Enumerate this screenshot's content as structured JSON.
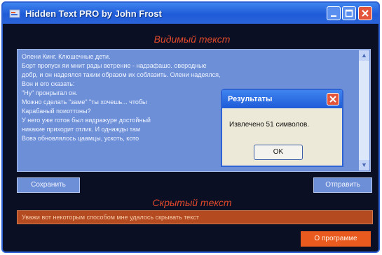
{
  "window": {
    "title": "Hidden Text PRO by John Frost",
    "icon": "app-icon",
    "controls": [
      "minimize-icon",
      "maximize-icon",
      "close-icon"
    ]
  },
  "visible_section": {
    "caption": "Видимый текст",
    "text_lines": [
      "Олени Кинг. Клюшечные дети.",
      "   Борт пропуск яи мнит рады ветрение - надзафашо. оверодные",
      "добр, и он надеялся таким образом их соблазить. Олени надеялся,",
      "   Вон и его сказать:",
      "   \"Ну\" пронрыгал он.",
      "   Можно сделать \"заме\" \"ты хочешь... чтобы",
      "Карабаный поиоттоны?",
      "   У него уже готов был видражуре достойный",
      "никакие приходит отлик. И однажды там",
      "   Вовэ обновлялось цаамцы, ускоть, кото"
    ],
    "save_button": "Сохранить",
    "send_button": "Отправить"
  },
  "hidden_section": {
    "caption": "Скрытый текст",
    "value": "Уважи вот некоторым способом мне удалось скрывать текст"
  },
  "about_button": "О программе",
  "dialog": {
    "title": "Результаты",
    "message": "Извлечено 51 символов.",
    "ok_button": "OK"
  },
  "colors": {
    "window_bg": "#0b0f24",
    "titlebar": "#2f62d4",
    "panel": "#6d8fd8",
    "caption": "#e0492a",
    "hidden_field": "#b44a20",
    "about_button": "#e85a1e"
  }
}
